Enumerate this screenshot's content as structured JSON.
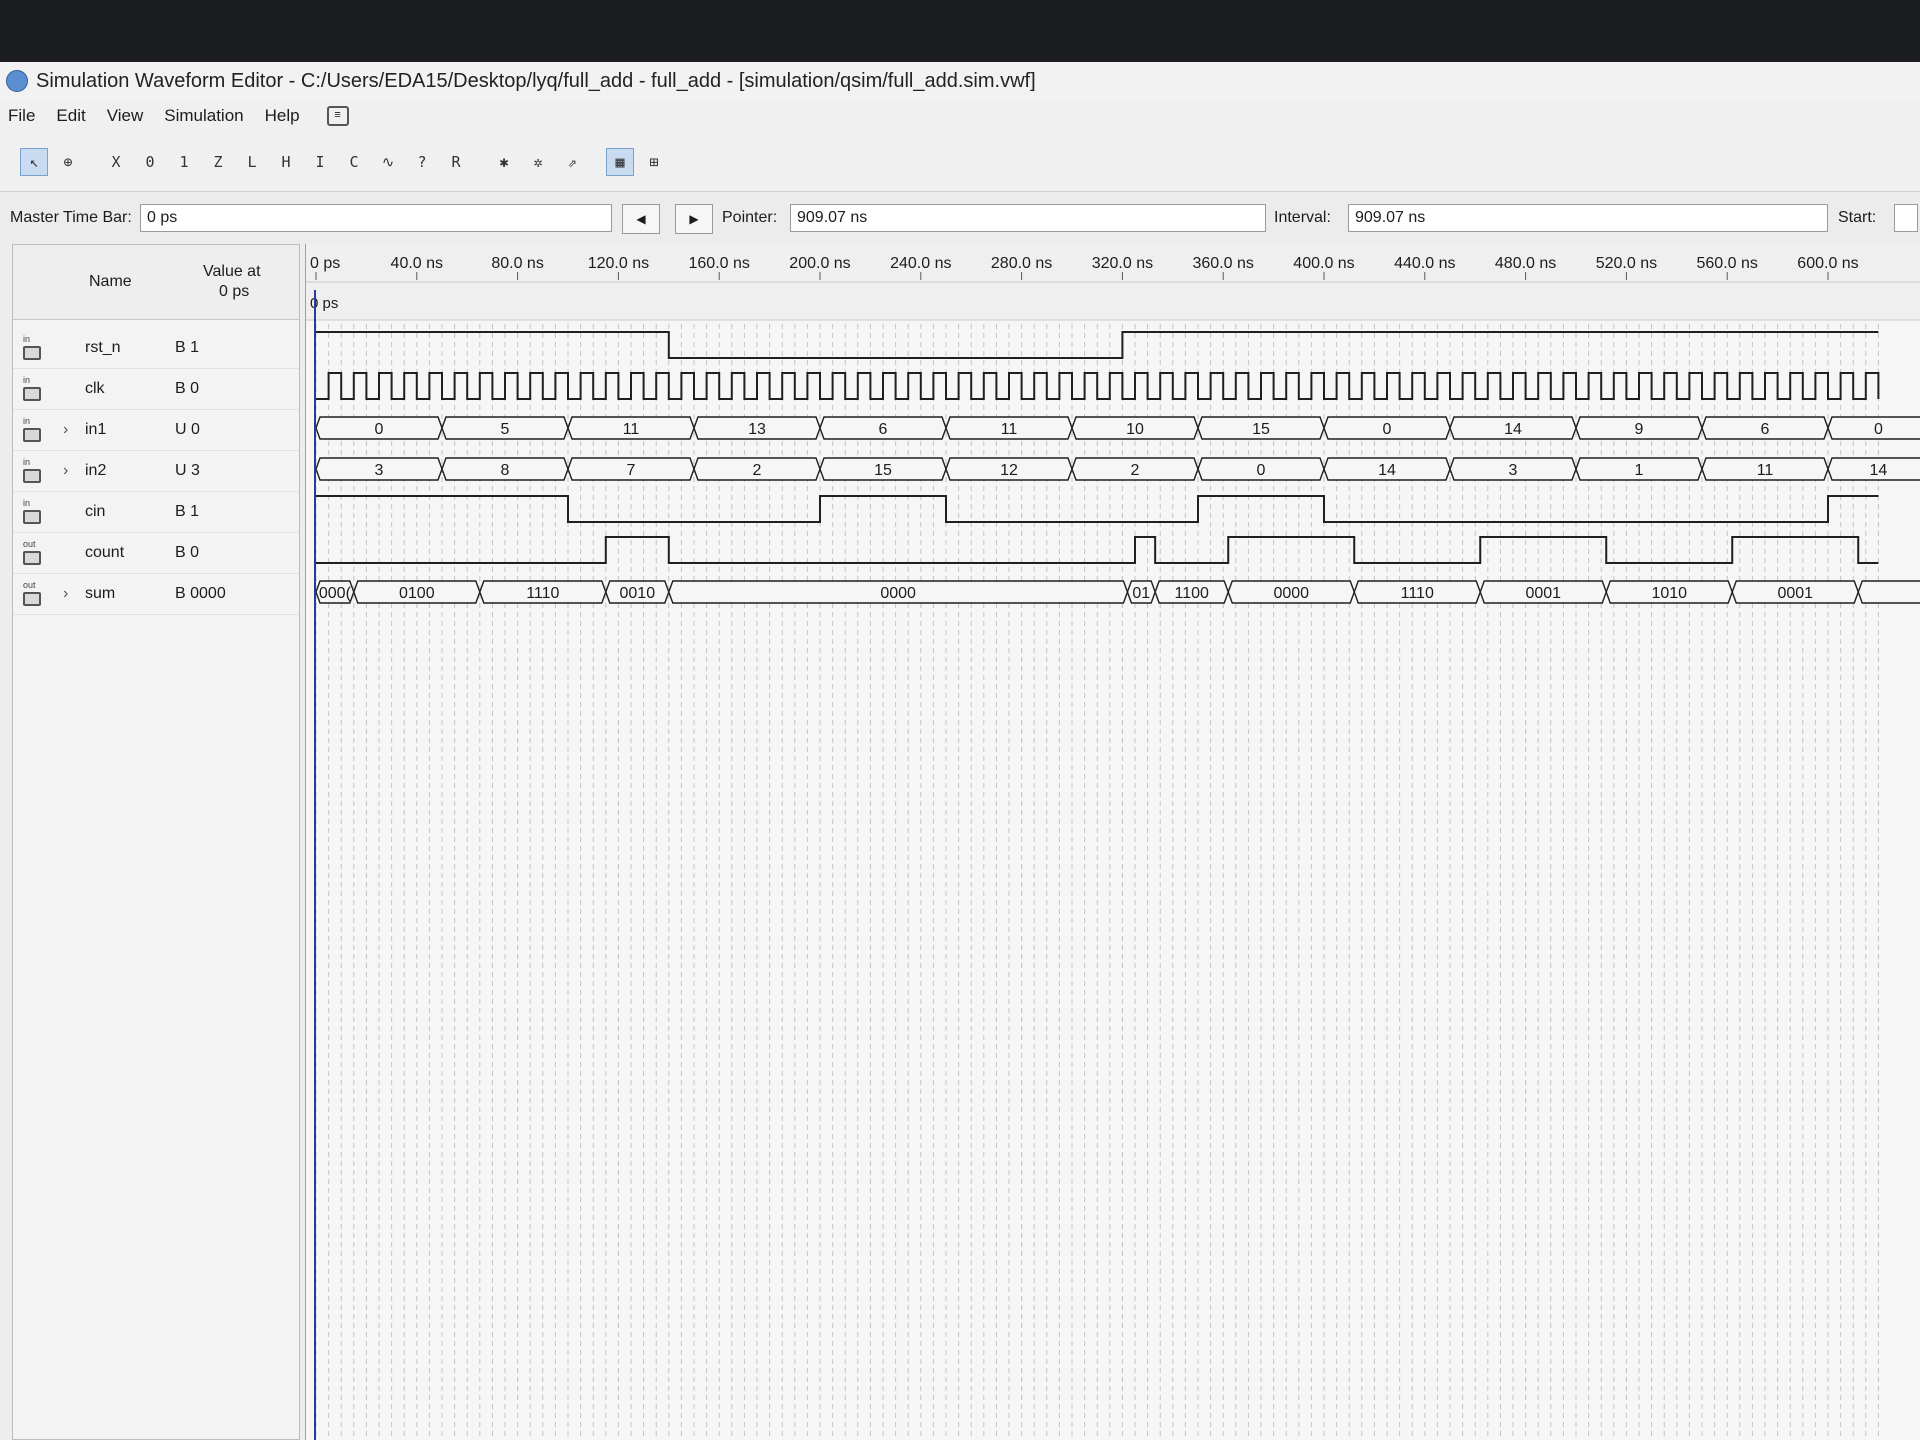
{
  "window": {
    "title": "Simulation Waveform Editor - C:/Users/EDA15/Desktop/lyq/full_add - full_add - [simulation/qsim/full_add.sim.vwf]"
  },
  "menu": [
    "File",
    "Edit",
    "View",
    "Simulation",
    "Help"
  ],
  "toolbar": {
    "tools": [
      {
        "name": "selection-tool-icon",
        "glyph": "↖"
      },
      {
        "name": "zoom-tool-icon",
        "glyph": "⊕"
      },
      {
        "name": "force-unknown-icon",
        "glyph": "X"
      },
      {
        "name": "force-low-icon",
        "glyph": "0"
      },
      {
        "name": "force-high-icon",
        "glyph": "1"
      },
      {
        "name": "force-high-impedance-icon",
        "glyph": "Z"
      },
      {
        "name": "force-weak-low-icon",
        "glyph": "L"
      },
      {
        "name": "force-weak-high-icon",
        "glyph": "H"
      },
      {
        "name": "invert-icon",
        "glyph": "I"
      },
      {
        "name": "count-value-icon",
        "glyph": "C"
      },
      {
        "name": "clock-icon",
        "glyph": "∿"
      },
      {
        "name": "arbitrary-value-icon",
        "glyph": "?"
      },
      {
        "name": "random-value-icon",
        "glyph": "R"
      },
      {
        "name": "functional-simulation-icon",
        "glyph": "✱"
      },
      {
        "name": "timing-simulation-icon",
        "glyph": "✲"
      },
      {
        "name": "generate-netlist-icon",
        "glyph": "⇗"
      },
      {
        "name": "snap-to-grid-icon",
        "glyph": "▦"
      },
      {
        "name": "group-icon",
        "glyph": "⊞"
      }
    ]
  },
  "timebar": {
    "master_label": "Master Time Bar:",
    "master_value": "0 ps",
    "pointer_label": "Pointer:",
    "pointer_value": "909.07 ns",
    "interval_label": "Interval:",
    "interval_value": "909.07 ns",
    "start_label": "Start:"
  },
  "table": {
    "name_header": "Name",
    "value_header_1": "Value at",
    "value_header_2": "0 ps"
  },
  "ruler": {
    "labels": [
      "0 ps",
      "40.0 ns",
      "80.0 ns",
      "120.0 ns",
      "160.0 ns",
      "200.0 ns",
      "240.0 ns",
      "280.0 ns",
      "320.0 ns",
      "360.0 ns",
      "400.0 ns",
      "440.0 ns",
      "480.0 ns",
      "520.0 ns",
      "560.0 ns",
      "600.0 ns"
    ],
    "cursor_label": "0 ps"
  },
  "signals": [
    {
      "io": "in",
      "name": "rst_n",
      "value": "B 1",
      "expandable": false
    },
    {
      "io": "in",
      "name": "clk",
      "value": "B 0",
      "expandable": false
    },
    {
      "io": "in",
      "name": "in1",
      "value": "U 0",
      "expandable": true
    },
    {
      "io": "in",
      "name": "in2",
      "value": "U 3",
      "expandable": true
    },
    {
      "io": "in",
      "name": "cin",
      "value": "B 1",
      "expandable": false
    },
    {
      "io": "out",
      "name": "count",
      "value": "B 0",
      "expandable": false
    },
    {
      "io": "out",
      "name": "sum",
      "value": "B 0000",
      "expandable": true
    }
  ],
  "chart_data": {
    "type": "timing",
    "time_unit": "ns",
    "x_range": [
      0,
      620
    ],
    "tick_step_ns": 40,
    "clock_period_ns": 10,
    "digital": [
      {
        "name": "rst_n",
        "transitions": [
          [
            0,
            1
          ],
          [
            140,
            0
          ],
          [
            320,
            1
          ]
        ]
      },
      {
        "name": "clk",
        "clock_period_ns": 10,
        "start_level": 0
      },
      {
        "name": "cin",
        "transitions": [
          [
            0,
            1
          ],
          [
            100,
            0
          ],
          [
            200,
            1
          ],
          [
            250,
            0
          ],
          [
            350,
            1
          ],
          [
            400,
            0
          ],
          [
            600,
            1
          ]
        ]
      },
      {
        "name": "count",
        "transitions": [
          [
            0,
            0
          ],
          [
            115,
            1
          ],
          [
            140,
            0
          ],
          [
            325,
            1
          ],
          [
            333,
            0
          ],
          [
            362,
            1
          ],
          [
            412,
            0
          ],
          [
            462,
            1
          ],
          [
            512,
            0
          ],
          [
            562,
            1
          ],
          [
            612,
            0
          ]
        ]
      }
    ],
    "bus": [
      {
        "name": "in1",
        "segments": [
          {
            "start": 0,
            "end": 50,
            "value": "0"
          },
          {
            "start": 50,
            "end": 100,
            "value": "5"
          },
          {
            "start": 100,
            "end": 150,
            "value": "11"
          },
          {
            "start": 150,
            "end": 200,
            "value": "13"
          },
          {
            "start": 200,
            "end": 250,
            "value": "6"
          },
          {
            "start": 250,
            "end": 300,
            "value": "11"
          },
          {
            "start": 300,
            "end": 350,
            "value": "10"
          },
          {
            "start": 350,
            "end": 400,
            "value": "15"
          },
          {
            "start": 400,
            "end": 450,
            "value": "0"
          },
          {
            "start": 450,
            "end": 500,
            "value": "14"
          },
          {
            "start": 500,
            "end": 550,
            "value": "9"
          },
          {
            "start": 550,
            "end": 600,
            "value": "6"
          },
          {
            "start": 600,
            "end": 650,
            "value": "0"
          }
        ]
      },
      {
        "name": "in2",
        "segments": [
          {
            "start": 0,
            "end": 50,
            "value": "3"
          },
          {
            "start": 50,
            "end": 100,
            "value": "8"
          },
          {
            "start": 100,
            "end": 150,
            "value": "7"
          },
          {
            "start": 150,
            "end": 200,
            "value": "2"
          },
          {
            "start": 200,
            "end": 250,
            "value": "15"
          },
          {
            "start": 250,
            "end": 300,
            "value": "12"
          },
          {
            "start": 300,
            "end": 350,
            "value": "2"
          },
          {
            "start": 350,
            "end": 400,
            "value": "0"
          },
          {
            "start": 400,
            "end": 450,
            "value": "14"
          },
          {
            "start": 450,
            "end": 500,
            "value": "3"
          },
          {
            "start": 500,
            "end": 550,
            "value": "1"
          },
          {
            "start": 550,
            "end": 600,
            "value": "11"
          },
          {
            "start": 600,
            "end": 650,
            "value": "14"
          }
        ]
      },
      {
        "name": "sum",
        "segments": [
          {
            "start": 0,
            "end": 15,
            "value": "000("
          },
          {
            "start": 15,
            "end": 65,
            "value": "0100"
          },
          {
            "start": 65,
            "end": 115,
            "value": "1110"
          },
          {
            "start": 115,
            "end": 140,
            "value": "0010"
          },
          {
            "start": 140,
            "end": 322,
            "value": "0000"
          },
          {
            "start": 322,
            "end": 333,
            "value": "01"
          },
          {
            "start": 333,
            "end": 362,
            "value": "1100"
          },
          {
            "start": 362,
            "end": 412,
            "value": "0000"
          },
          {
            "start": 412,
            "end": 462,
            "value": "1110"
          },
          {
            "start": 462,
            "end": 512,
            "value": "0001"
          },
          {
            "start": 512,
            "end": 562,
            "value": "1010"
          },
          {
            "start": 562,
            "end": 612,
            "value": "0001"
          },
          {
            "start": 612,
            "end": 650,
            "value": ""
          }
        ]
      }
    ]
  },
  "colors": {
    "wave": "#1f1f1f",
    "cursor": "#2a3a9a",
    "grid": "#c4c4c4",
    "selected_tool": "#c8dbf0"
  }
}
